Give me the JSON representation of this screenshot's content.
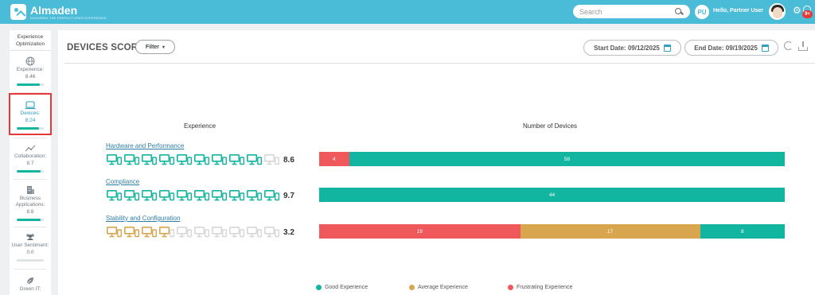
{
  "app": {
    "logo_name": "Almaden",
    "logo_tagline": "ENSURING THE PERFECT USER EXPERIENCE",
    "search_placeholder": "Search",
    "user_initials": "PU",
    "user_greeting": "Hello, Partner User",
    "notification_count": "9+"
  },
  "sidebar": {
    "title_line1": "Experience",
    "title_line2": "Optimization",
    "items": [
      {
        "label": "Experience:",
        "score": "8.46",
        "level": 0.85,
        "icon": "globe-icon"
      },
      {
        "label": "Devices:",
        "score": "8.24",
        "level": 0.82,
        "icon": "laptop-icon",
        "active": true
      },
      {
        "label": "Collaboration:",
        "score": "8.7",
        "level": 0.87,
        "icon": "trend-icon"
      },
      {
        "label": "Business Applications:",
        "score": "8.8",
        "level": 0.88,
        "icon": "building-icon"
      },
      {
        "label": "User Sentiment:",
        "score": "0.0",
        "level": 0.0,
        "icon": "users-icon"
      },
      {
        "label": "Green IT:",
        "score": "",
        "level": 0.0,
        "icon": "leaf-icon"
      }
    ]
  },
  "main": {
    "title": "DEVICES SCORE",
    "filter_label": "Filter",
    "start_date": "Start Date: 09/12/2025",
    "end_date": "End Date: 09/19/2025",
    "experience_header": "Experience",
    "devices_header": "Number of Devices"
  },
  "colors": {
    "good": "#12b5a0",
    "average": "#d9a54e",
    "frustrating": "#f0595c",
    "empty_icon": "#d7d7d7"
  },
  "chart_data": {
    "type": "bar",
    "orientation": "horizontal-stacked",
    "categories": [
      "Hardware and Performance",
      "Compliance",
      "Stability and Configuration"
    ],
    "scores": [
      "8.6",
      "9.7",
      "3.2"
    ],
    "icon_ratings": [
      {
        "filled": 9,
        "total": 10,
        "color": "good"
      },
      {
        "filled": 10,
        "total": 10,
        "color": "good"
      },
      {
        "filled": 3.5,
        "total": 10,
        "color": "average"
      }
    ],
    "series": [
      {
        "name": "Frustrating Experience",
        "values": [
          4,
          0,
          19
        ],
        "color": "#f0595c"
      },
      {
        "name": "Average Experience",
        "values": [
          0,
          0,
          17
        ],
        "color": "#d9a54e"
      },
      {
        "name": "Good Experience",
        "values": [
          58,
          44,
          8
        ],
        "color": "#12b5a0"
      }
    ],
    "legend": [
      "Good Experience",
      "Average Experience",
      "Frustrating Experience"
    ],
    "legend_position": "bottom"
  }
}
